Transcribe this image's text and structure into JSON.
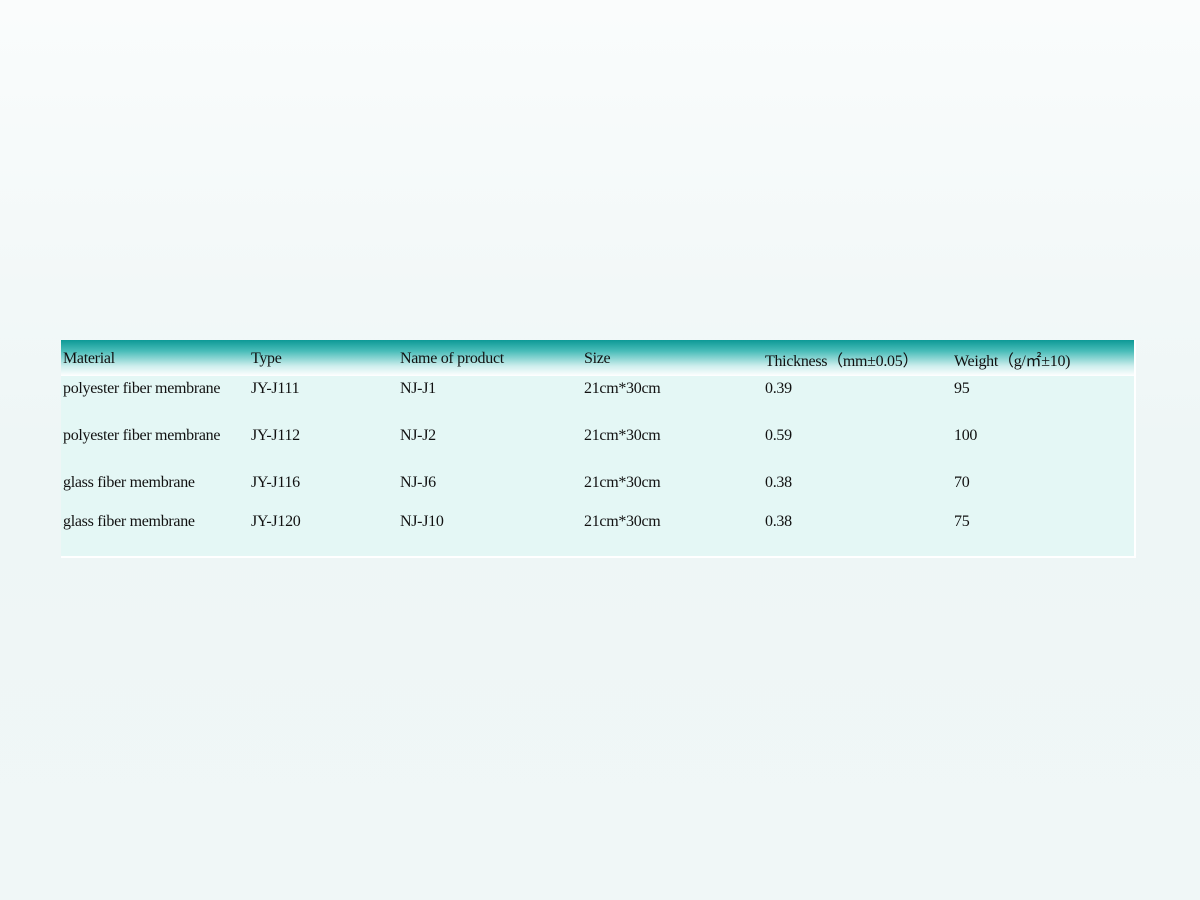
{
  "table": {
    "headers": [
      "Material",
      "Type",
      "Name of product",
      "Size",
      "Thickness（mm±0.05）",
      "Weight（g/㎡±10)"
    ],
    "rows": [
      [
        "polyester fiber membrane",
        "JY-J111",
        "NJ-J1",
        "21cm*30cm",
        "0.39",
        "95"
      ],
      [
        "polyester fiber membrane",
        "JY-J112",
        "NJ-J2",
        "21cm*30cm",
        "0.59",
        "100"
      ],
      [
        "glass fiber membrane",
        "JY-J116",
        "NJ-J6",
        "21cm*30cm",
        "0.38",
        "70"
      ],
      [
        "glass fiber membrane",
        "JY-J120",
        "NJ-J10",
        "21cm*30cm",
        "0.38",
        "75"
      ]
    ]
  },
  "colors": {
    "header_top": "#0d9996",
    "body_background": "#e4f7f5",
    "page_background": "#f0f7f7"
  }
}
